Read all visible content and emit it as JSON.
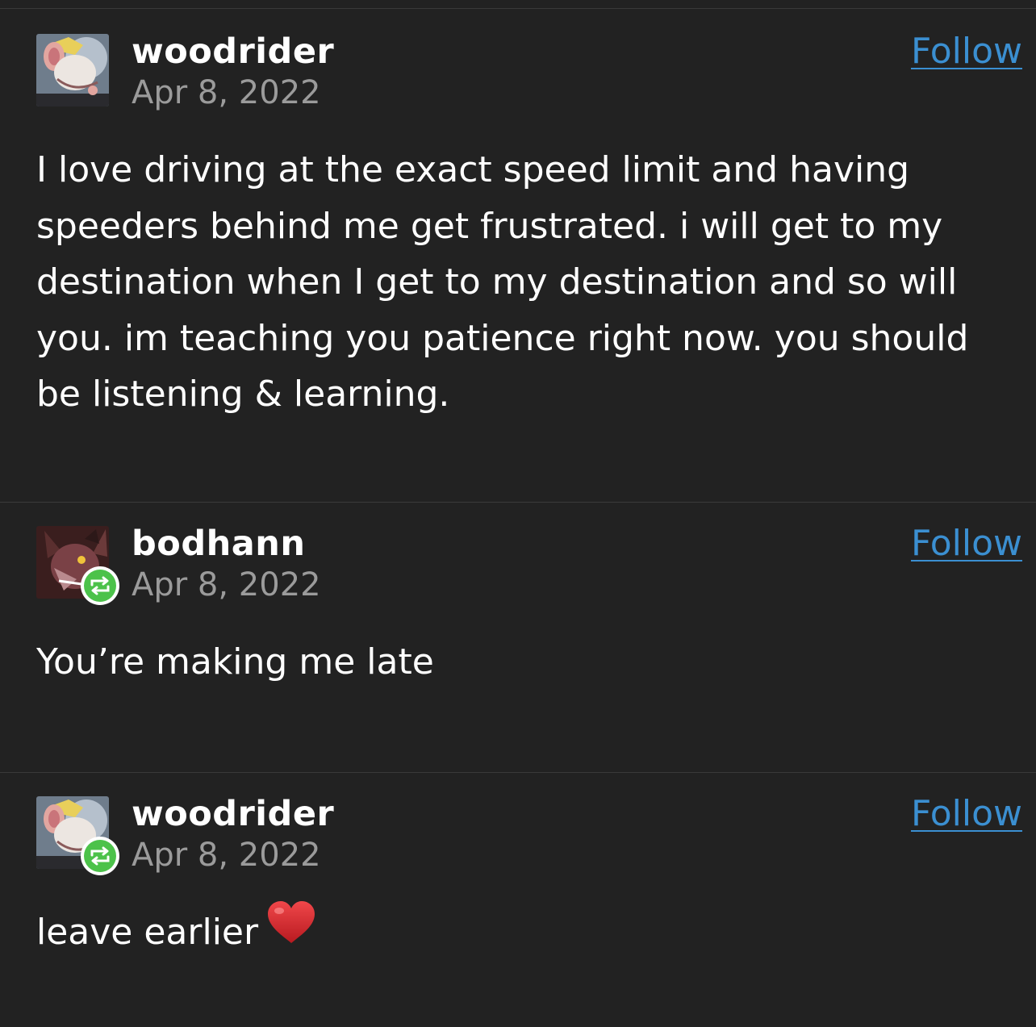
{
  "posts": [
    {
      "username": "woodrider",
      "date": "Apr 8, 2022",
      "follow_label": "Follow",
      "text": "I love driving at the exact speed limit and having speeders behind me get frustrated. i will get to my destination when I get to my destination and so will you. im teaching you patience right now. you should be listening & learning.",
      "reblog": false,
      "avatar": "rat-character-avatar"
    },
    {
      "username": "bodhann",
      "date": "Apr 8, 2022",
      "follow_label": "Follow",
      "text": "You’re making me late",
      "reblog": true,
      "avatar": "wolf-character-avatar"
    },
    {
      "username": "woodrider",
      "date": "Apr 8, 2022",
      "follow_label": "Follow",
      "text": "leave earlier",
      "emoji": "red-heart",
      "reblog": true,
      "avatar": "rat-character-avatar"
    }
  ],
  "colors": {
    "background": "#222222",
    "link": "#3b8fd1",
    "date": "#9b9b9b",
    "reblog_badge": "#4cc24a",
    "heart": "#d8262b"
  }
}
